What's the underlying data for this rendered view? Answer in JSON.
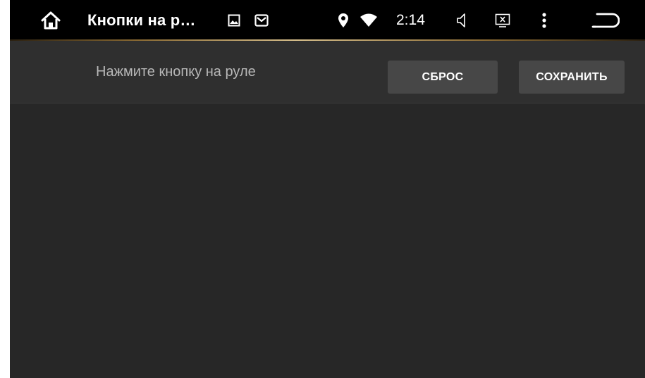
{
  "status_bar": {
    "title": "Кнопки на р…",
    "time": "2:14",
    "icons": {
      "home": "home-icon",
      "image": "image-icon",
      "mail": "mail-icon",
      "location": "location-icon",
      "wifi": "wifi-icon",
      "volume": "volume-icon",
      "screen": "screen-off-icon",
      "menu": "more-vert-icon",
      "back": "back-icon"
    }
  },
  "toolbar": {
    "hint": "Нажмите кнопку на руле",
    "reset_label": "СБРОС",
    "save_label": "СОХРАНИТЬ"
  },
  "colors": {
    "background": "#2f2f2f",
    "panel": "#272727",
    "button": "#474747",
    "status_bar": "#000000",
    "accent_line": "#d8c08c"
  }
}
